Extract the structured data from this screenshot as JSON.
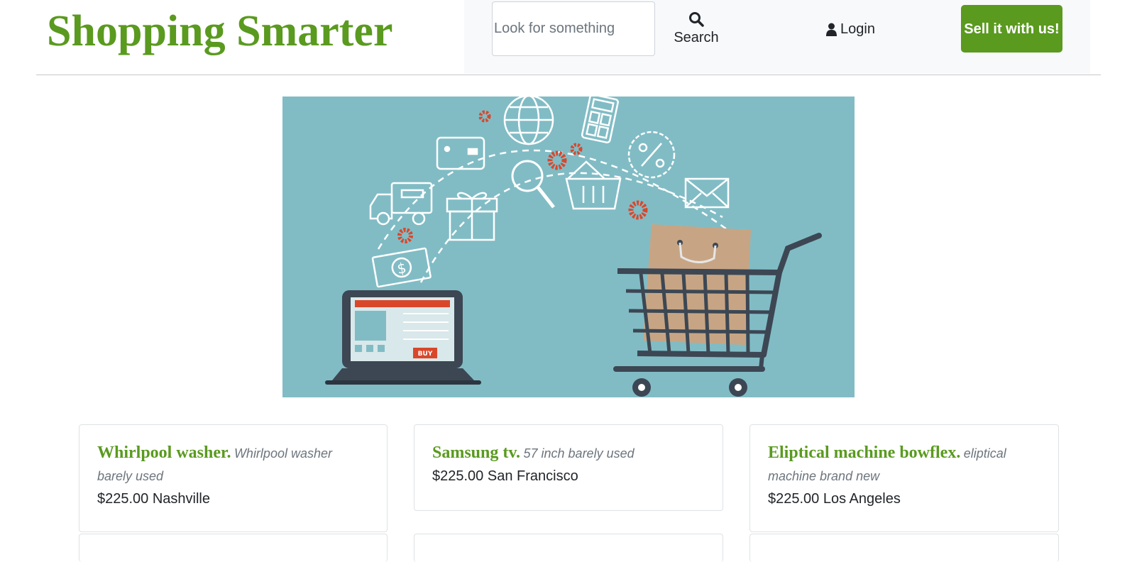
{
  "header": {
    "brand": "Shopping Smarter",
    "search_placeholder": "Look for something",
    "search_label": "Search",
    "login_label": "Login",
    "sell_label": "Sell it with us!"
  },
  "hero": {
    "buy_label": "BUY",
    "colors": {
      "background": "#81bcc5",
      "accent": "#d9472b",
      "dark": "#3c4753"
    }
  },
  "listings": [
    {
      "title": "Whirlpool washer.",
      "description": "Whirlpool washer barely used",
      "price": "$225.00",
      "location": "Nashville"
    },
    {
      "title": "Samsung tv.",
      "description": "57 inch barely used",
      "price": "$225.00",
      "location": "San Francisco"
    },
    {
      "title": "Eliptical machine bowflex.",
      "description": "eliptical machine brand new",
      "price": "$225.00",
      "location": "Los Angeles"
    }
  ],
  "colors": {
    "brand_green": "#5a9a1f",
    "nav_background": "#f8f9fa"
  }
}
